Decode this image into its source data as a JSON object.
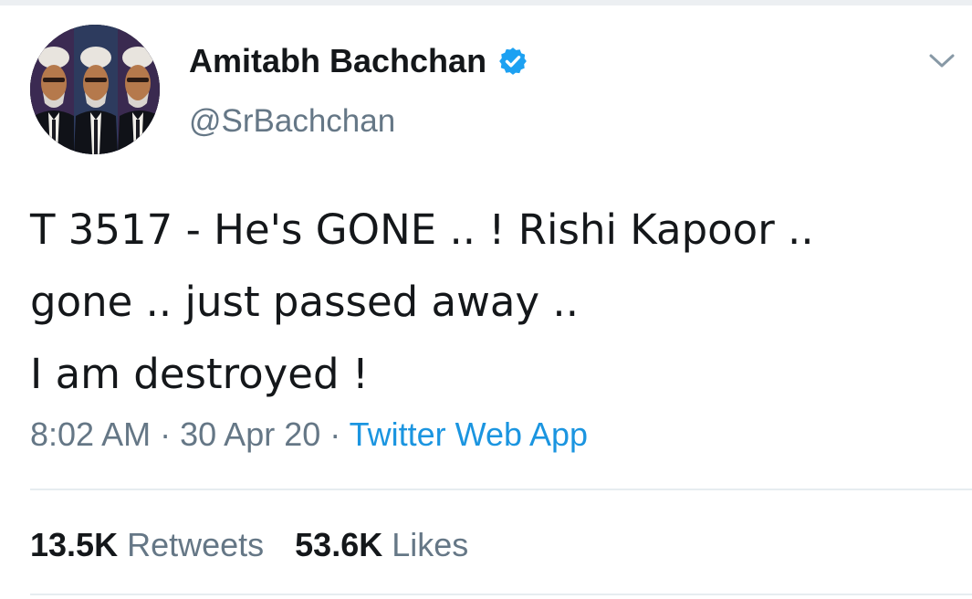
{
  "tweet": {
    "author": {
      "display_name": "Amitabh Bachchan",
      "handle": "@SrBachchan",
      "verified": true,
      "avatar_icon": "profile-photo"
    },
    "menu_icon": "chevron-down-icon",
    "text_lines": [
      "T 3517 - He's GONE .. ! Rishi Kapoor ..",
      "gone .. just passed away ..",
      "I am destroyed !"
    ],
    "meta": {
      "time": "8:02 AM",
      "separator": "·",
      "date": "30 Apr 20",
      "source": "Twitter Web App"
    },
    "stats": {
      "retweets_count": "13.5K",
      "retweets_label": "Retweets",
      "likes_count": "53.6K",
      "likes_label": "Likes"
    }
  },
  "colors": {
    "text_primary": "#14171a",
    "text_secondary": "#657786",
    "link": "#1b95e0",
    "verified_badge": "#1da1f2",
    "divider": "#e6ecf0"
  }
}
